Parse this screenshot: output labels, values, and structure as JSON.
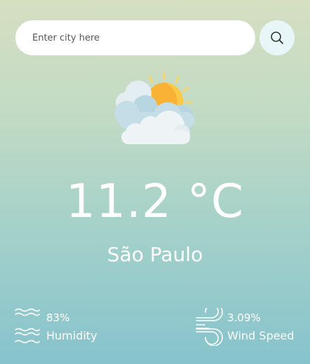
{
  "search": {
    "placeholder": "Enter city here",
    "value": ""
  },
  "weather": {
    "icon": "partly-cloudy-icon",
    "temperature": "11.2 °C",
    "city": "São Paulo"
  },
  "humidity": {
    "value": "83%",
    "label": "Humidity",
    "icon": "humidity-waves-icon"
  },
  "wind": {
    "value": "3.09%",
    "label": "Wind Speed",
    "icon": "wind-icon"
  },
  "colors": {
    "background_top": "#d6dfc2",
    "background_bottom": "#86c3cd",
    "search_button_bg": "#e8f6f7",
    "text": "#ffffff",
    "sun": "#f9b233",
    "cloud": "#e4eef2"
  }
}
